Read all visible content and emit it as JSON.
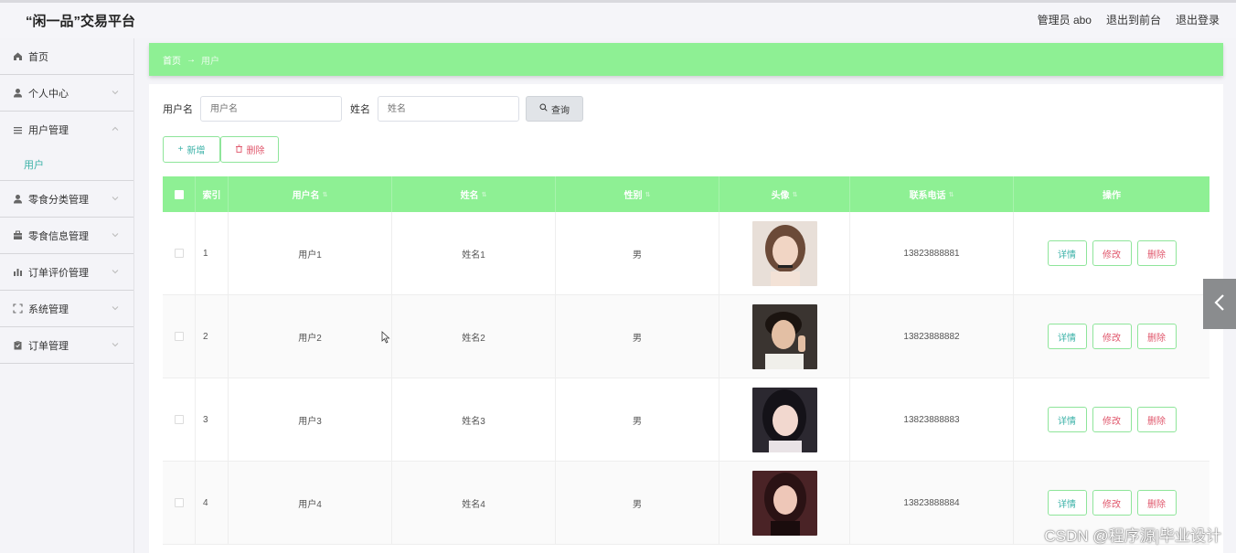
{
  "app": {
    "title": "“闲一品”交易平台"
  },
  "header": {
    "admin": "管理员 abo",
    "back_front": "退出到前台",
    "logout": "退出登录"
  },
  "sidebar": {
    "items": [
      {
        "label": "首页",
        "icon": "home-icon"
      },
      {
        "label": "个人中心",
        "icon": "user-icon"
      },
      {
        "label": "用户管理",
        "icon": "list-icon",
        "expanded": true,
        "sub": [
          "用户"
        ]
      },
      {
        "label": "零食分类管理",
        "icon": "user-icon"
      },
      {
        "label": "零食信息管理",
        "icon": "briefcase-icon"
      },
      {
        "label": "订单评价管理",
        "icon": "bar-chart-icon"
      },
      {
        "label": "系统管理",
        "icon": "frame-icon"
      },
      {
        "label": "订单管理",
        "icon": "clipboard-icon"
      }
    ]
  },
  "breadcrumb": {
    "home": "首页",
    "arrow": "→",
    "current": "用户"
  },
  "search": {
    "username_label": "用户名",
    "username_placeholder": "用户名",
    "name_label": "姓名",
    "name_placeholder": "姓名",
    "query_label": "查询"
  },
  "toolbar": {
    "add_label": "新增",
    "delete_label": "删除"
  },
  "table": {
    "headers": [
      "索引",
      "用户名",
      "姓名",
      "性别",
      "头像",
      "联系电话",
      "操作"
    ],
    "rows": [
      {
        "index": "1",
        "username": "用户1",
        "name": "姓名1",
        "gender": "男",
        "phone": "13823888881"
      },
      {
        "index": "2",
        "username": "用户2",
        "name": "姓名2",
        "gender": "男",
        "phone": "13823888882"
      },
      {
        "index": "3",
        "username": "用户3",
        "name": "姓名3",
        "gender": "男",
        "phone": "13823888883"
      },
      {
        "index": "4",
        "username": "用户4",
        "name": "姓名4",
        "gender": "男",
        "phone": "13823888884"
      }
    ],
    "row_actions": {
      "detail": "详情",
      "edit": "修改",
      "delete": "删除"
    }
  },
  "watermark": "CSDN @程序源|毕业设计",
  "colors": {
    "accent": "#8ef094",
    "teal": "#3cb2a8",
    "danger": "#e0576c"
  }
}
